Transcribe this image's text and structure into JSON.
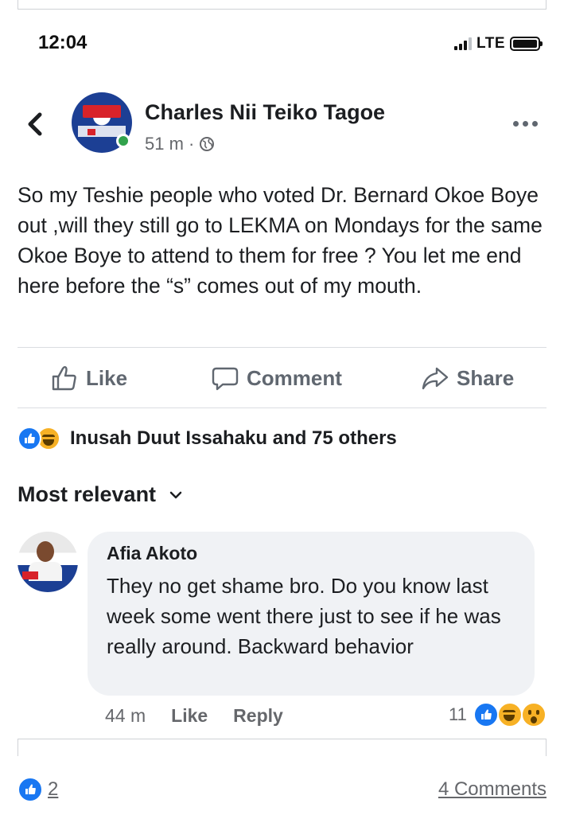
{
  "status_bar": {
    "time": "12:04",
    "network": "LTE"
  },
  "post": {
    "author": "Charles Nii Teiko Tagoe",
    "time_ago": "51 m ·",
    "privacy_icon": "globe-icon",
    "text": "So my Teshie people who voted Dr. Bernard Okoe Boye out ,will they still go to LEKMA on Mondays for the same Okoe Boye to attend to them for free ? You let me end here before the “s” comes out of my mouth.",
    "actions": {
      "like": "Like",
      "comment": "Comment",
      "share": "Share"
    },
    "reactions_summary": "Inusah Duut Issahaku and 75 others"
  },
  "comments_section": {
    "sort_label": "Most relevant",
    "comments": [
      {
        "author": "Afia Akoto",
        "text": "They no get shame bro. Do you know last week some went there just to see if he was really around. Backward behavior",
        "time_ago": "44 m",
        "like_label": "Like",
        "reply_label": "Reply",
        "reaction_count": "11"
      }
    ]
  },
  "footer": {
    "like_count": "2",
    "comments_link": "4 Comments"
  },
  "colors": {
    "facebook_blue": "#1877f2",
    "online_green": "#31a24c",
    "bubble_bg": "#f0f2f5",
    "secondary_text": "#65676b"
  }
}
